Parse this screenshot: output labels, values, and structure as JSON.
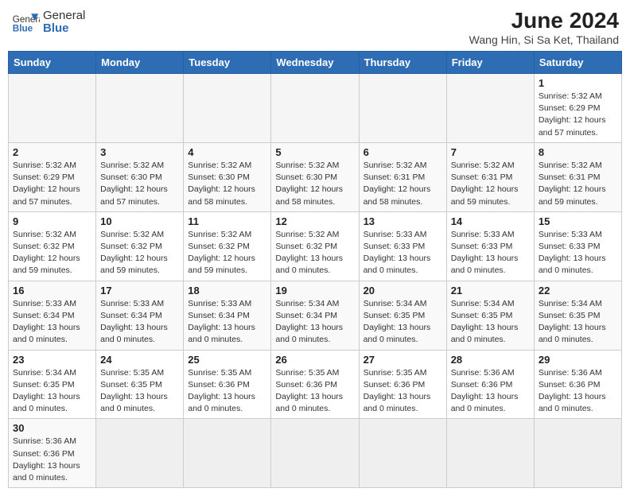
{
  "header": {
    "logo_text_normal": "General",
    "logo_text_bold": "Blue",
    "main_title": "June 2024",
    "subtitle": "Wang Hin, Si Sa Ket, Thailand"
  },
  "weekdays": [
    "Sunday",
    "Monday",
    "Tuesday",
    "Wednesday",
    "Thursday",
    "Friday",
    "Saturday"
  ],
  "weeks": [
    [
      {
        "day": "",
        "info": ""
      },
      {
        "day": "",
        "info": ""
      },
      {
        "day": "",
        "info": ""
      },
      {
        "day": "",
        "info": ""
      },
      {
        "day": "",
        "info": ""
      },
      {
        "day": "",
        "info": ""
      },
      {
        "day": "1",
        "info": "Sunrise: 5:32 AM\nSunset: 6:29 PM\nDaylight: 12 hours and 57 minutes."
      }
    ],
    [
      {
        "day": "2",
        "info": "Sunrise: 5:32 AM\nSunset: 6:29 PM\nDaylight: 12 hours and 57 minutes."
      },
      {
        "day": "3",
        "info": "Sunrise: 5:32 AM\nSunset: 6:30 PM\nDaylight: 12 hours and 57 minutes."
      },
      {
        "day": "4",
        "info": "Sunrise: 5:32 AM\nSunset: 6:30 PM\nDaylight: 12 hours and 58 minutes."
      },
      {
        "day": "5",
        "info": "Sunrise: 5:32 AM\nSunset: 6:30 PM\nDaylight: 12 hours and 58 minutes."
      },
      {
        "day": "6",
        "info": "Sunrise: 5:32 AM\nSunset: 6:31 PM\nDaylight: 12 hours and 58 minutes."
      },
      {
        "day": "7",
        "info": "Sunrise: 5:32 AM\nSunset: 6:31 PM\nDaylight: 12 hours and 59 minutes."
      },
      {
        "day": "8",
        "info": "Sunrise: 5:32 AM\nSunset: 6:31 PM\nDaylight: 12 hours and 59 minutes."
      }
    ],
    [
      {
        "day": "9",
        "info": "Sunrise: 5:32 AM\nSunset: 6:32 PM\nDaylight: 12 hours and 59 minutes."
      },
      {
        "day": "10",
        "info": "Sunrise: 5:32 AM\nSunset: 6:32 PM\nDaylight: 12 hours and 59 minutes."
      },
      {
        "day": "11",
        "info": "Sunrise: 5:32 AM\nSunset: 6:32 PM\nDaylight: 12 hours and 59 minutes."
      },
      {
        "day": "12",
        "info": "Sunrise: 5:32 AM\nSunset: 6:32 PM\nDaylight: 13 hours and 0 minutes."
      },
      {
        "day": "13",
        "info": "Sunrise: 5:33 AM\nSunset: 6:33 PM\nDaylight: 13 hours and 0 minutes."
      },
      {
        "day": "14",
        "info": "Sunrise: 5:33 AM\nSunset: 6:33 PM\nDaylight: 13 hours and 0 minutes."
      },
      {
        "day": "15",
        "info": "Sunrise: 5:33 AM\nSunset: 6:33 PM\nDaylight: 13 hours and 0 minutes."
      }
    ],
    [
      {
        "day": "16",
        "info": "Sunrise: 5:33 AM\nSunset: 6:34 PM\nDaylight: 13 hours and 0 minutes."
      },
      {
        "day": "17",
        "info": "Sunrise: 5:33 AM\nSunset: 6:34 PM\nDaylight: 13 hours and 0 minutes."
      },
      {
        "day": "18",
        "info": "Sunrise: 5:33 AM\nSunset: 6:34 PM\nDaylight: 13 hours and 0 minutes."
      },
      {
        "day": "19",
        "info": "Sunrise: 5:34 AM\nSunset: 6:34 PM\nDaylight: 13 hours and 0 minutes."
      },
      {
        "day": "20",
        "info": "Sunrise: 5:34 AM\nSunset: 6:35 PM\nDaylight: 13 hours and 0 minutes."
      },
      {
        "day": "21",
        "info": "Sunrise: 5:34 AM\nSunset: 6:35 PM\nDaylight: 13 hours and 0 minutes."
      },
      {
        "day": "22",
        "info": "Sunrise: 5:34 AM\nSunset: 6:35 PM\nDaylight: 13 hours and 0 minutes."
      }
    ],
    [
      {
        "day": "23",
        "info": "Sunrise: 5:34 AM\nSunset: 6:35 PM\nDaylight: 13 hours and 0 minutes."
      },
      {
        "day": "24",
        "info": "Sunrise: 5:35 AM\nSunset: 6:35 PM\nDaylight: 13 hours and 0 minutes."
      },
      {
        "day": "25",
        "info": "Sunrise: 5:35 AM\nSunset: 6:36 PM\nDaylight: 13 hours and 0 minutes."
      },
      {
        "day": "26",
        "info": "Sunrise: 5:35 AM\nSunset: 6:36 PM\nDaylight: 13 hours and 0 minutes."
      },
      {
        "day": "27",
        "info": "Sunrise: 5:35 AM\nSunset: 6:36 PM\nDaylight: 13 hours and 0 minutes."
      },
      {
        "day": "28",
        "info": "Sunrise: 5:36 AM\nSunset: 6:36 PM\nDaylight: 13 hours and 0 minutes."
      },
      {
        "day": "29",
        "info": "Sunrise: 5:36 AM\nSunset: 6:36 PM\nDaylight: 13 hours and 0 minutes."
      }
    ],
    [
      {
        "day": "30",
        "info": "Sunrise: 5:36 AM\nSunset: 6:36 PM\nDaylight: 13 hours and 0 minutes."
      },
      {
        "day": "",
        "info": ""
      },
      {
        "day": "",
        "info": ""
      },
      {
        "day": "",
        "info": ""
      },
      {
        "day": "",
        "info": ""
      },
      {
        "day": "",
        "info": ""
      },
      {
        "day": "",
        "info": ""
      }
    ]
  ]
}
